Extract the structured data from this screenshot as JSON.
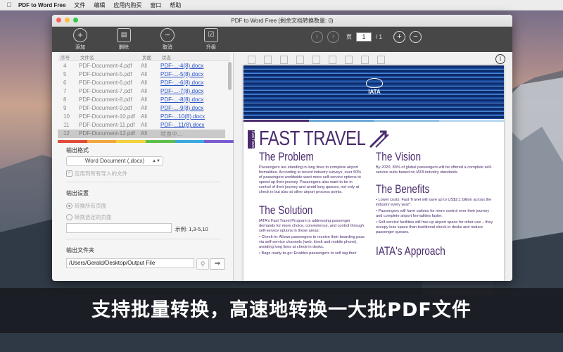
{
  "menubar": {
    "app": "PDF to Word Free",
    "items": [
      "文件",
      "编辑",
      "应用内购买",
      "窗口",
      "帮助"
    ]
  },
  "window": {
    "title": "PDF to Word Free (剩余文档转换数量: 0)"
  },
  "toolbar": {
    "add": "添加",
    "delete": "删除",
    "cancel": "取消",
    "upgrade": "升级"
  },
  "nav": {
    "page_label": "页",
    "page_value": "1",
    "total": "/ 1"
  },
  "file_list": {
    "headers": [
      "序号",
      "文件名",
      "页面",
      "状态"
    ],
    "rows": [
      {
        "n": "4",
        "name": "PDF-Document-4.pdf",
        "pages": "All",
        "status": "PDF-...-4(8).docx"
      },
      {
        "n": "5",
        "name": "PDF-Document-5.pdf",
        "pages": "All",
        "status": "PDF-...-5(8).docx"
      },
      {
        "n": "6",
        "name": "PDF-Document-6.pdf",
        "pages": "All",
        "status": "PDF-...-6(8).docx"
      },
      {
        "n": "7",
        "name": "PDF-Document-7.pdf",
        "pages": "All",
        "status": "PDF-...-7(8).docx"
      },
      {
        "n": "8",
        "name": "PDF-Document-8.pdf",
        "pages": "All",
        "status": "PDF-...-8(8).docx"
      },
      {
        "n": "9",
        "name": "PDF-Document-9.pdf",
        "pages": "All",
        "status": "PDF-...-9(8).docx"
      },
      {
        "n": "10",
        "name": "PDF-Document-10.pdf",
        "pages": "All",
        "status": "PDF-...10(8).docx"
      },
      {
        "n": "11",
        "name": "PDF-Document-11.pdf",
        "pages": "All",
        "status": "PDF-...11(8).docx"
      },
      {
        "n": "12",
        "name": "PDF-Document-12.pdf",
        "pages": "All",
        "status": "转换中..."
      }
    ]
  },
  "output": {
    "format_title": "输出格式",
    "format_value": "Word Document (.docx)",
    "apply_all": "应用到所有导入的文件",
    "settings_title": "输出设置",
    "convert_all": "转换所有页面",
    "convert_selected": "转换选定的页面",
    "example": "示例: 1,3-5,10",
    "folder_title": "输出文件夹",
    "folder_path": "/Users/Gerald/Desktop/Output File"
  },
  "document": {
    "logo": "IATA",
    "tab": "Fast Travel",
    "title": "FAST TRAVEL",
    "problem_h": "The Problem",
    "problem_p": "Passengers are standing in long lines to complete airport formalities. According to recent industry surveys, over 50% of passengers worldwide want more self-service options to speed up their journey. Passengers also want to be in control of their journey and avoid long queues, not only at check in but also at other airport process points.",
    "solution_h": "The Solution",
    "solution_p": "IATA's Fast Travel Program is addressing passenger demands for more choice, convenience, and control through self-service options in these areas:",
    "solution_b1": "Check-in: Allows passengers to receive their boarding pass via self-service channels (web, kiosk and mobile phone), avoiding long lines at check-in desks.",
    "solution_b2": "Bags ready-to-go: Enables passengers to self tag their",
    "vision_h": "The Vision",
    "vision_p": "By 2020, 80% of global passengers will be offered a complete self-service suite based on IATA industry standards.",
    "benefits_h": "The Benefits",
    "benefits_b1": "Lower costs: Fast Travel will save up to US$2.1 billion across the industry every year*.",
    "benefits_b2": "Passengers will have options for more control over their journey and complete airport formalities faster.",
    "benefits_b3": "Self-service facilities will free up airport space for other use – they occupy less space than traditional check-in desks and reduce passenger queues.",
    "approach_h": "IATA's Approach"
  },
  "caption": "支持批量转换，高速地转换一大批PDF文件",
  "colors": {
    "accent_purple": "#4b2c6e",
    "link_blue": "#2a52c9",
    "toolbar": "#474747"
  }
}
